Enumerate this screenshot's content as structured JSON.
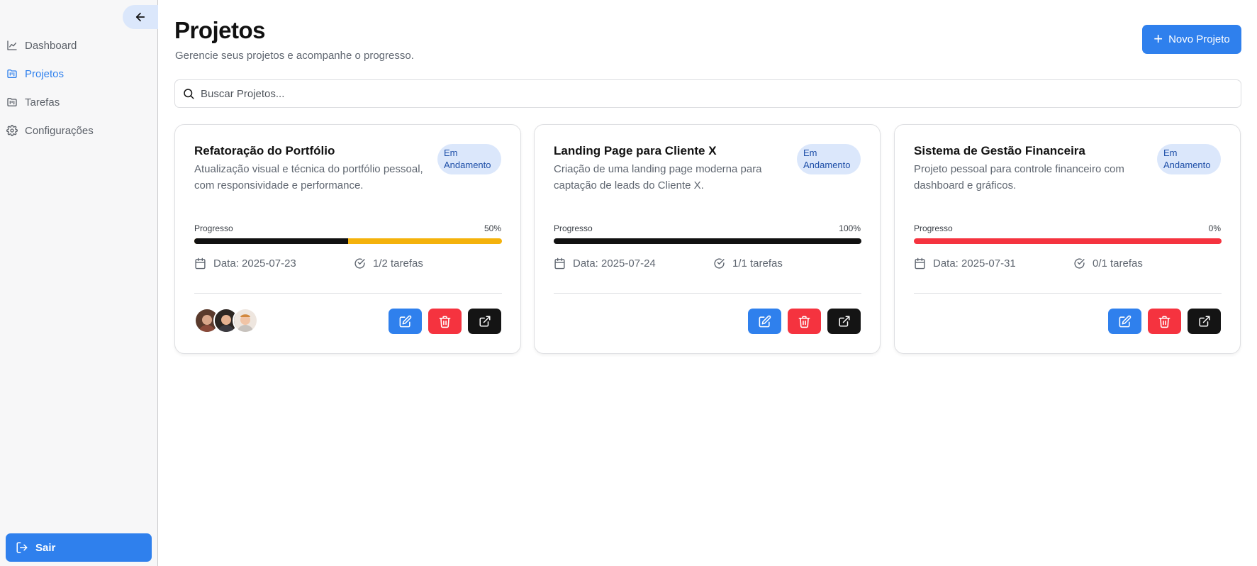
{
  "sidebar": {
    "items": [
      {
        "label": "Dashboard",
        "icon": "chart-line-icon",
        "active": false
      },
      {
        "label": "Projetos",
        "icon": "folder-kanban-icon",
        "active": true
      },
      {
        "label": "Tarefas",
        "icon": "folder-kanban-icon",
        "active": false
      },
      {
        "label": "Configurações",
        "icon": "gear-icon",
        "active": false
      }
    ],
    "logout_label": "Sair"
  },
  "header": {
    "title": "Projetos",
    "subtitle": "Gerencie seus projetos e acompanhe o progresso.",
    "new_button": "Novo Projeto"
  },
  "search": {
    "placeholder": "Buscar Projetos..."
  },
  "projects": [
    {
      "title": "Refatoração do Portfólio",
      "description": "Atualização visual e técnica do portfólio pessoal, com responsividade e performance.",
      "status_line1": "Em",
      "status_line2": "Andamento",
      "progress_label": "Progresso",
      "progress_text": "50%",
      "progress": 50,
      "track_color": "#f4b20c",
      "date": "Data: 2025-07-23",
      "tasks": "1/2 tarefas",
      "avatars": 3
    },
    {
      "title": "Landing Page para Cliente X",
      "description": "Criação de uma landing page moderna para captação de leads do Cliente X.",
      "status_line1": "Em",
      "status_line2": "Andamento",
      "progress_label": "Progresso",
      "progress_text": "100%",
      "progress": 100,
      "track_color": "#f4b20c",
      "date": "Data: 2025-07-24",
      "tasks": "1/1 tarefas",
      "avatars": 0
    },
    {
      "title": "Sistema de Gestão Financeira",
      "description": "Projeto pessoal para controle financeiro com dashboard e gráficos.",
      "status_line1": "Em",
      "status_line2": "Andamento",
      "progress_label": "Progresso",
      "progress_text": "0%",
      "progress": 0,
      "track_color": "#f5333f",
      "date": "Data: 2025-07-31",
      "tasks": "0/1 tarefas",
      "avatars": 0
    }
  ],
  "colors": {
    "accent": "#2f80ed",
    "danger": "#f5333f",
    "dark": "#141414",
    "badge_bg": "#dbe7fb"
  }
}
